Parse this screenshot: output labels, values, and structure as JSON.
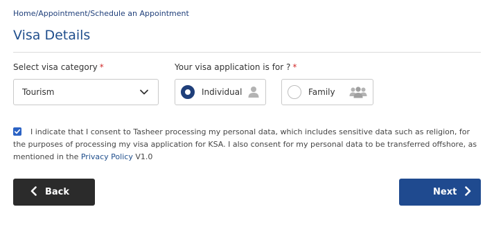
{
  "breadcrumb": "Home/Appointment/Schedule an Appointment",
  "page_title": "Visa Details",
  "visa_category": {
    "label": "Select visa category",
    "required_mark": "*",
    "selected_value": "Tourism",
    "icon": "chevron-down-icon"
  },
  "application_for": {
    "label": "Your visa application is for ?",
    "required_mark": "*",
    "options": [
      {
        "label": "Individual",
        "selected": true,
        "icon": "person-icon"
      },
      {
        "label": "Family",
        "selected": false,
        "icon": "group-icon"
      }
    ]
  },
  "consent": {
    "checked": true,
    "text": "I indicate that I consent to Tasheer processing my personal data, which includes sensitive data such as religion, for the purposes of processing my visa application for KSA. I also consent for my personal data to be transferred offshore, as mentioned in the ",
    "link_text": "Privacy Policy",
    "suffix": " V1.0"
  },
  "buttons": {
    "back_label": "Back",
    "next_label": "Next"
  },
  "colors": {
    "primary": "#1f4a8f",
    "back_button": "#2b2b2b",
    "required": "#d22b2b",
    "link": "#1f4e8c"
  }
}
